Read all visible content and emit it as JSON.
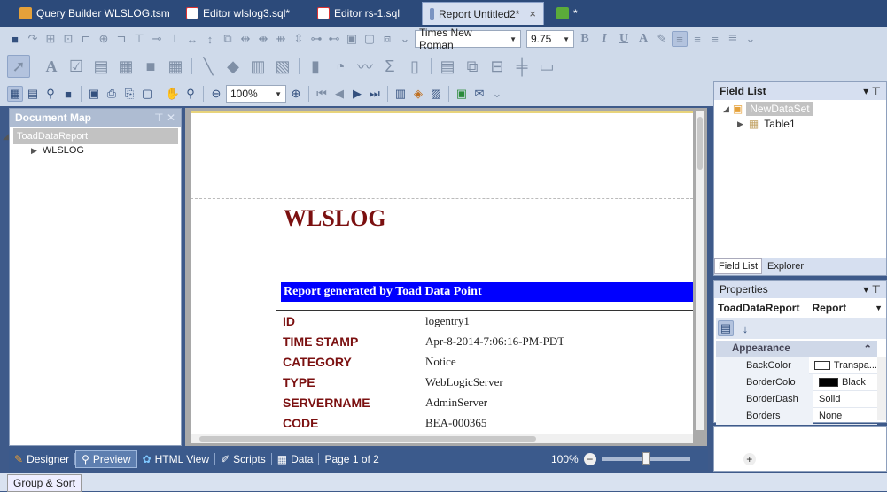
{
  "tabs": [
    {
      "label": "Query Builder WLSLOG.tsm",
      "color": "#e5a13a"
    },
    {
      "label": "Editor wlslog3.sql*",
      "color": "#d33"
    },
    {
      "label": "Editor rs-1.sql",
      "color": "#d33"
    },
    {
      "label": "Report Untitled2*",
      "color": "#7a93c2",
      "close": "×"
    },
    {
      "label": "*",
      "color": "#5bab3a"
    }
  ],
  "toolbar": {
    "font_family": "Times New Roman",
    "font_size": "9.75",
    "zoom": "100%",
    "format_buttons": [
      "B",
      "I",
      "U",
      "A"
    ]
  },
  "document_map": {
    "title": "Document Map",
    "root": "ToadDataReport",
    "child": "WLSLOG"
  },
  "report": {
    "title": "WLSLOG",
    "banner": "Report generated by Toad Data Point",
    "fields": [
      {
        "label": "ID",
        "value": "logentry1"
      },
      {
        "label": "TIME STAMP",
        "value": "Apr-8-2014-7:06:16-PM-PDT"
      },
      {
        "label": "CATEGORY",
        "value": "Notice"
      },
      {
        "label": "TYPE",
        "value": "WebLogicServer"
      },
      {
        "label": "SERVERNAME",
        "value": "AdminServer"
      },
      {
        "label": "CODE",
        "value": "BEA-000365"
      }
    ]
  },
  "field_list": {
    "title": "Field List",
    "root": "NewDataSet",
    "child": "Table1",
    "tabs": [
      "Field List",
      "Explorer"
    ]
  },
  "properties": {
    "title": "Properties",
    "object": "ToadDataReport",
    "object_type": "Report",
    "category": "Appearance",
    "rows": [
      {
        "name": "BackColor",
        "value": "Transpa...",
        "swatch": "#ffffff"
      },
      {
        "name": "BorderColo",
        "value": "Black",
        "swatch": "#000000"
      },
      {
        "name": "BorderDash",
        "value": "Solid"
      },
      {
        "name": "Borders",
        "value": "None"
      }
    ]
  },
  "statusbar": {
    "items": [
      "Designer",
      "Preview",
      "HTML View",
      "Scripts",
      "Data"
    ],
    "page_info": "Page 1 of 2",
    "zoom": "100%",
    "zoom_level": 0.5
  },
  "bottom": {
    "group_sort": "Group & Sort"
  }
}
